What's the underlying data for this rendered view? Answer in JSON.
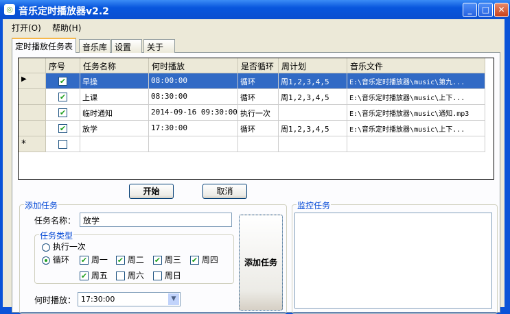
{
  "window": {
    "title": "音乐定时播放器v2.2"
  },
  "menu": [
    "打开(O)",
    "帮助(H)"
  ],
  "tabs": [
    "定时播放任务表",
    "音乐库",
    "设置",
    "关于"
  ],
  "grid": {
    "columns": [
      "序号",
      "任务名称",
      "何时播放",
      "是否循环",
      "周计划",
      "音乐文件"
    ],
    "rows": [
      {
        "checked": true,
        "name": "早操",
        "time": "08:00:00",
        "loop": "循环",
        "week": "周1,2,3,4,5",
        "file": "E:\\音乐定时播放器\\music\\第九..."
      },
      {
        "checked": true,
        "name": "上课",
        "time": "08:30:00",
        "loop": "循环",
        "week": "周1,2,3,4,5",
        "file": "E:\\音乐定时播放器\\music\\上下..."
      },
      {
        "checked": true,
        "name": "临时通知",
        "time": "2014-09-16 09:30:00",
        "loop": "执行一次",
        "week": "",
        "file": "E:\\音乐定时播放器\\music\\通知.mp3"
      },
      {
        "checked": true,
        "name": "放学",
        "time": "17:30:00",
        "loop": "循环",
        "week": "周1,2,3,4,5",
        "file": "E:\\音乐定时播放器\\music\\上下..."
      }
    ],
    "new_row_marker": "*",
    "current_row_marker": "▶"
  },
  "buttons": {
    "start": "开始",
    "cancel": "取消",
    "add_task": "添加任务"
  },
  "add_task": {
    "group_label": "添加任务",
    "name_label": "任务名称：",
    "name_value": "放学",
    "type_group_label": "任务类型",
    "radio_once": "执行一次",
    "radio_loop": "循环",
    "selected": "循环",
    "days": [
      {
        "label": "周一",
        "checked": true
      },
      {
        "label": "周二",
        "checked": true
      },
      {
        "label": "周三",
        "checked": true
      },
      {
        "label": "周四",
        "checked": true
      },
      {
        "label": "周五",
        "checked": true
      },
      {
        "label": "周六",
        "checked": false
      },
      {
        "label": "周日",
        "checked": false
      }
    ],
    "time_label": "何时播放：",
    "time_value": "17:30:00"
  },
  "monitor": {
    "group_label": "监控任务"
  }
}
